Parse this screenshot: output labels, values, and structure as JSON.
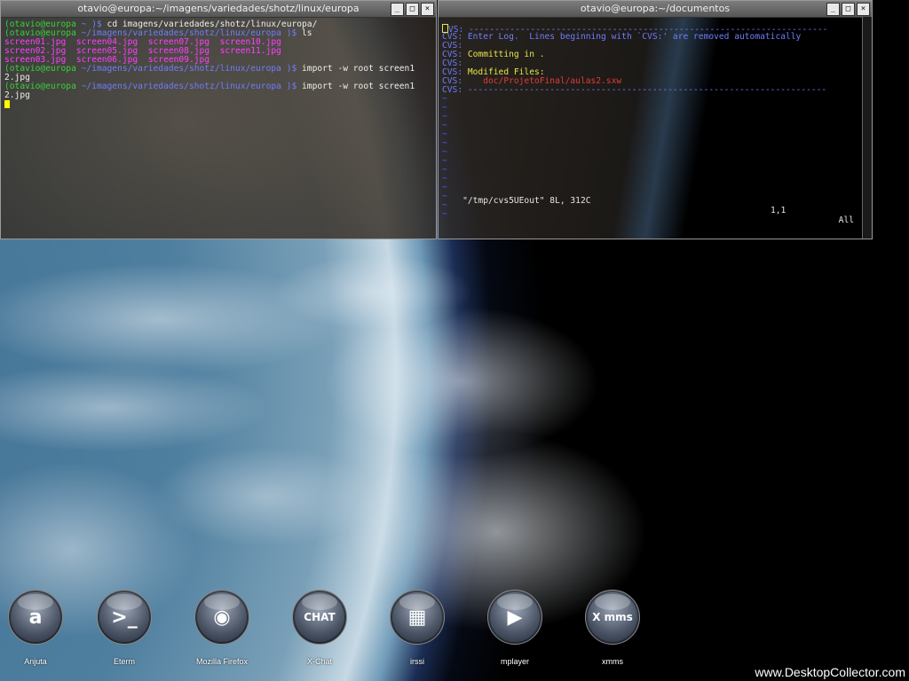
{
  "windows": [
    {
      "title": "otavio@europa:~/imagens/variedades/shotz/linux/europa",
      "buttons": [
        "_",
        "□",
        "×"
      ],
      "lines": [
        {
          "prompt": "(otavio@europa",
          "path": " ~ )$",
          "cmd": " cd imagens/variedades/shotz/linux/europa/"
        },
        {
          "prompt": "(otavio@europa",
          "path": " ~/imagens/variedades/shotz/linux/europa )$",
          "cmd": " ls"
        },
        {
          "files": [
            "screen01.jpg",
            "screen04.jpg",
            "screen07.jpg",
            "screen10.jpg"
          ]
        },
        {
          "files": [
            "screen02.jpg",
            "screen05.jpg",
            "screen08.jpg",
            "screen11.jpg"
          ]
        },
        {
          "files": [
            "screen03.jpg",
            "screen06.jpg",
            "screen09.jpg"
          ]
        },
        {
          "prompt": "(otavio@europa",
          "path": " ~/imagens/variedades/shotz/linux/europa )$",
          "cmd": " import -w root screen1"
        },
        {
          "text": "2.jpg"
        },
        {
          "prompt": "(otavio@europa",
          "path": " ~/imagens/variedades/shotz/linux/europa )$",
          "cmd": " import -w root screen1"
        },
        {
          "text": "2.jpg"
        }
      ]
    },
    {
      "title": "otavio@europa:~/documentos",
      "buttons": [
        "_",
        "□",
        "×"
      ],
      "cvs_lines": [
        {
          "p": "CVS:",
          "t": " ----------------------------------------------------------------------",
          "cls": "c-blue"
        },
        {
          "p": "CVS:",
          "t": " Enter Log.  Lines beginning with `CVS:' are removed automatically",
          "cls": "c-blue"
        },
        {
          "p": "CVS:",
          "t": "",
          "cls": "c-blue"
        },
        {
          "p": "CVS:",
          "t": " Committing in .",
          "cls": "c-yel"
        },
        {
          "p": "CVS:",
          "t": "",
          "cls": "c-blue"
        },
        {
          "p": "CVS:",
          "t": " Modified Files:",
          "cls": "c-yel"
        },
        {
          "p": "CVS:",
          "t": "    doc/ProjetoFinal/aulas2.sxw",
          "cls": "c-red"
        },
        {
          "p": "CVS:",
          "t": " ----------------------------------------------------------------------",
          "cls": "c-blue"
        }
      ],
      "tilde_count": 14,
      "status": {
        "file": "\"/tmp/cvs5UEout\" 8L, 312C",
        "pos": "1,1",
        "all": "All"
      }
    }
  ],
  "dock": [
    {
      "label": "Anjuta",
      "glyph": "a"
    },
    {
      "label": "Eterm",
      "glyph": ">_"
    },
    {
      "label": "Mozilla Firefox",
      "glyph": "◉"
    },
    {
      "label": "X-Chat",
      "glyph": "CHAT"
    },
    {
      "label": "irssi",
      "glyph": "▦"
    },
    {
      "label": "mplayer",
      "glyph": "▶"
    },
    {
      "label": "xmms",
      "glyph": "X mms"
    }
  ],
  "watermark": "www.DesktopCollector.com"
}
